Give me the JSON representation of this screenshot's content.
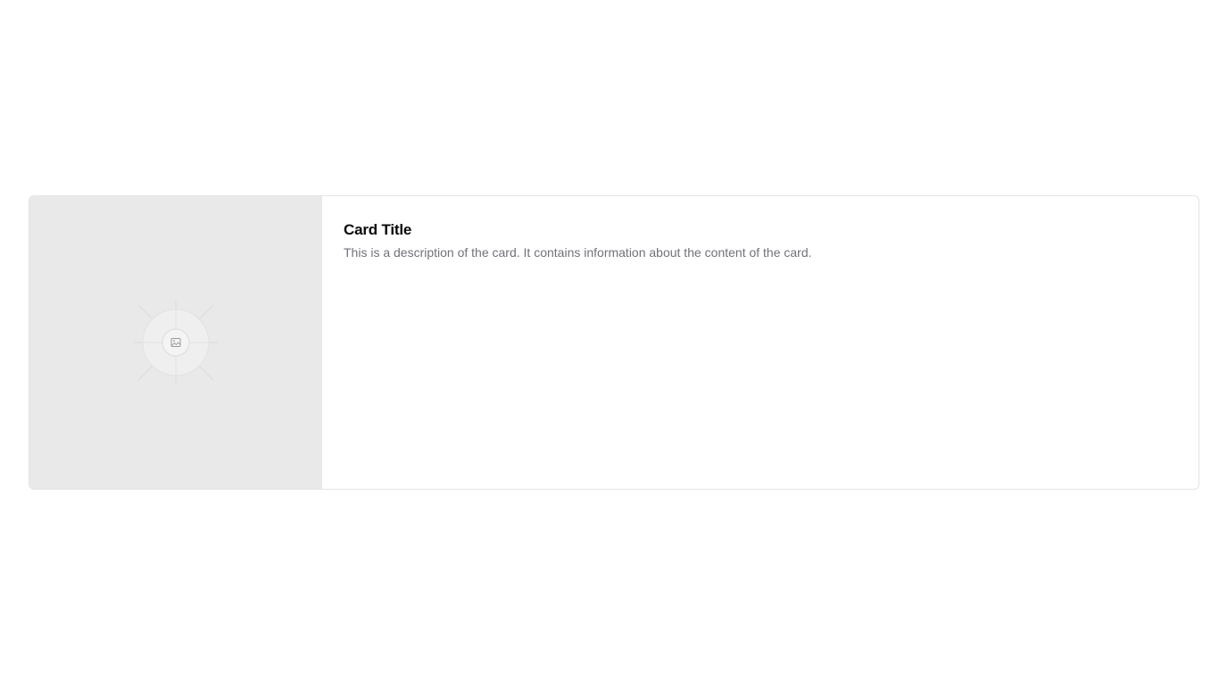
{
  "card": {
    "title": "Card Title",
    "description": "This is a description of the card. It contains information about the content of the card.",
    "media_icon": "image-placeholder-icon"
  },
  "colors": {
    "media_background": "#e9e9e9",
    "title": "#09090b",
    "description": "#71717a",
    "border": "#e4e4e7"
  }
}
